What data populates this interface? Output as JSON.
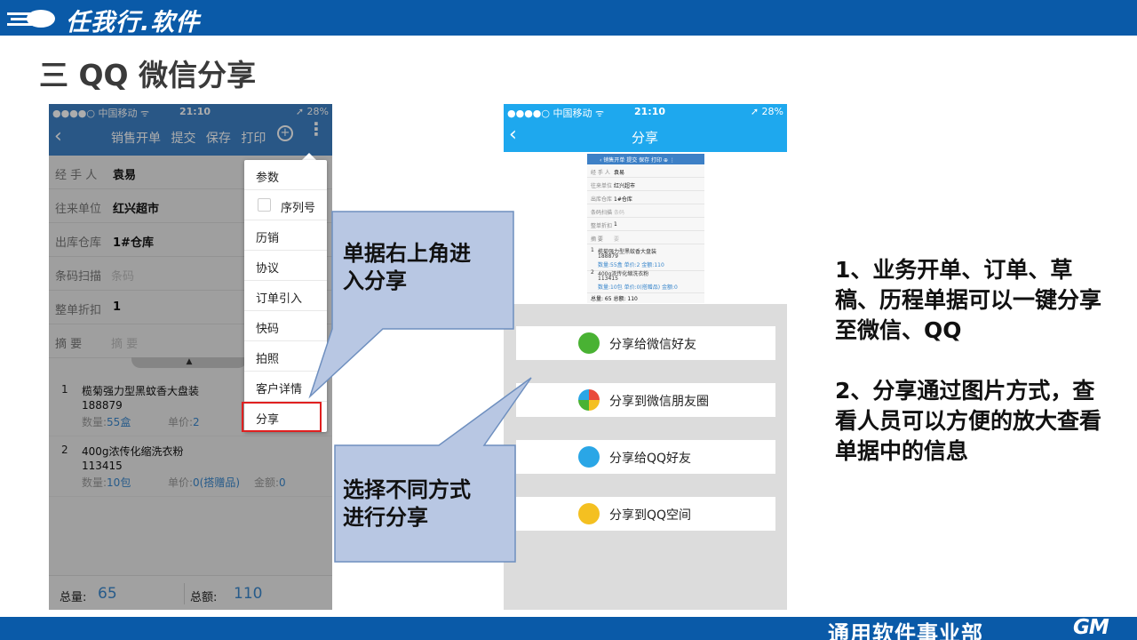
{
  "header": {
    "logo_text": "任我行.软件",
    "slide_title": "三  QQ 微信分享"
  },
  "footer": {
    "dept": "通用软件事业部",
    "logo": "GM"
  },
  "phone1": {
    "status": {
      "carrier": "●●●●○ 中国移动 ᯤ",
      "time": "21:10",
      "battery": "➚ 28%"
    },
    "nav": {
      "back": "‹",
      "actions": "销售开单 提交 保存 打印",
      "plus": "+",
      "more": "⋮"
    },
    "fields": [
      {
        "label": "经 手 人",
        "value": "袁易"
      },
      {
        "label": "往来单位",
        "value": "红兴超市"
      },
      {
        "label": "出库仓库",
        "value": "1#仓库"
      },
      {
        "label": "条码扫描",
        "placeholder": "条码"
      },
      {
        "label": "整单折扣",
        "value": "1"
      },
      {
        "label": "摘    要",
        "placeholder": "摘    要"
      }
    ],
    "tab": "▲",
    "items": [
      {
        "num": "1",
        "name": "榄菊强力型黑蚊香大盘装",
        "code": "188879",
        "qty_label": "数量:",
        "qty": "55盒",
        "price_label": "单价:",
        "price": "2"
      },
      {
        "num": "2",
        "name": "400g浓传化缩洗衣粉",
        "code": "113415",
        "qty_label": "数量:",
        "qty": "10包",
        "price_label": "单价:",
        "price": "0(搭赠品)",
        "amount_label": "金额:",
        "amount": "0"
      }
    ],
    "footer": {
      "total_qty_label": "总量:",
      "total_qty": "65",
      "total_amt_label": "总额:",
      "total_amt": "110"
    }
  },
  "menu": {
    "items": [
      "参数",
      "序列号",
      "历销",
      "协议",
      "订单引入",
      "快码",
      "拍照",
      "客户详情",
      "分享"
    ]
  },
  "callouts": {
    "top_line1": "单据右上角进",
    "top_line2": "入分享",
    "bottom_line1": "选择不同方式",
    "bottom_line2": "进行分享"
  },
  "phone2": {
    "status": {
      "carrier": "●●●●○ 中国移动 ᯤ",
      "time": "21:10",
      "battery": "➚ 28%"
    },
    "nav": {
      "back": "‹",
      "title": "分享"
    },
    "preview": {
      "nav": "‹   销售开单  提交  保存  打印  ⊕  ⋮",
      "rows": [
        {
          "k": "经 手 人",
          "v": "袁易"
        },
        {
          "k": "往来单位",
          "v": "红兴超市"
        },
        {
          "k": "出库仓库",
          "v": "1#仓库"
        },
        {
          "k": "条码扫描",
          "v": "条码"
        },
        {
          "k": "整单折扣",
          "v": "1"
        },
        {
          "k": "摘    要",
          "v": "要"
        }
      ],
      "items": [
        {
          "n": "1",
          "a1": "榄菊强力型黑蚊香大盘装",
          "a2": "188879",
          "a3": "数量:55盒     单价:2        金额:110"
        },
        {
          "n": "2",
          "a1": "400g浓传化缩洗衣粉",
          "a2": "113415",
          "a3": "数量:10包   单价:0(搭赠品)   金额:0"
        }
      ],
      "total": "总量: 65          总额: 110"
    },
    "share_options": [
      {
        "label": "分享给微信好友",
        "color": "#49b233"
      },
      {
        "label": "分享到微信朋友圈",
        "color": "#e8a33a"
      },
      {
        "label": "分享给QQ好友",
        "color": "#2aa6e6"
      },
      {
        "label": "分享到QQ空间",
        "color": "#f4c021"
      }
    ]
  },
  "notes": {
    "p1": "1、业务开单、订单、草稿、历程单据可以一键分享至微信、QQ",
    "p2": "2、分享通过图片方式，查看人员可以方便的放大查看单据中的信息"
  }
}
